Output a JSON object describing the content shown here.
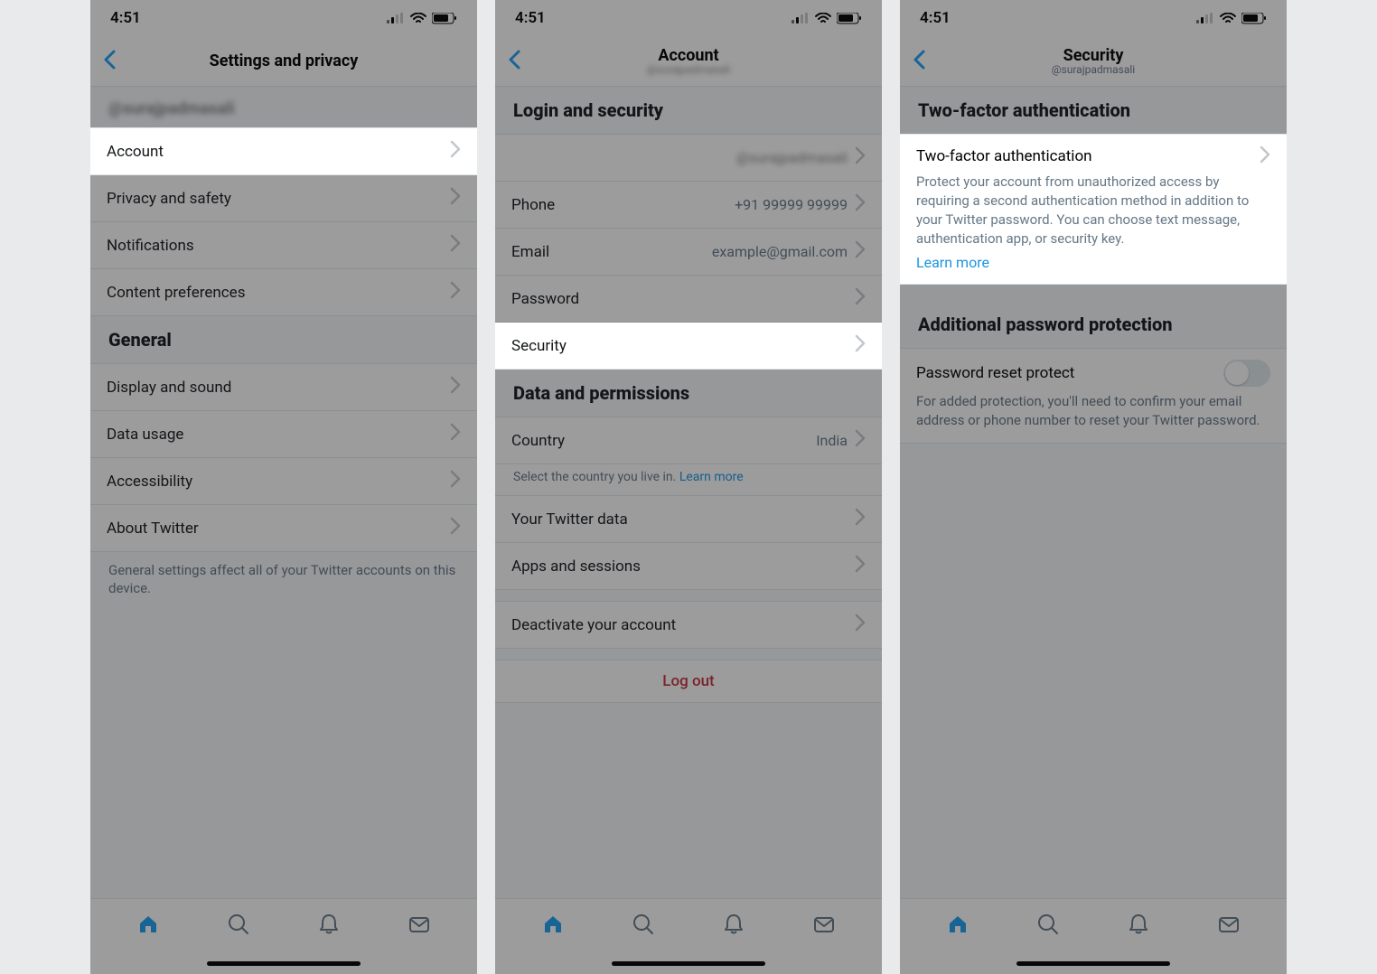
{
  "status": {
    "time": "4:51"
  },
  "screen1": {
    "title": "Settings and privacy",
    "username": "@surajpadmasali",
    "rows": {
      "account": "Account",
      "privacy": "Privacy and safety",
      "notifications": "Notifications",
      "content": "Content preferences"
    },
    "general_header": "General",
    "general": {
      "display": "Display and sound",
      "data": "Data usage",
      "accessibility": "Accessibility",
      "about": "About Twitter"
    },
    "general_note": "General settings affect all of your Twitter accounts on this device."
  },
  "screen2": {
    "title": "Account",
    "subtitle": "@surajpadmasali",
    "login_header": "Login and security",
    "rows": {
      "username_label": "",
      "username_value": "@surajpadmasali",
      "phone_label": "Phone",
      "phone_value": "+91 99999 99999",
      "email_label": "Email",
      "email_value": "example@gmail.com",
      "password_label": "Password",
      "security_label": "Security"
    },
    "data_header": "Data and permissions",
    "country_label": "Country",
    "country_value": "India",
    "country_note": "Select the country you live in. ",
    "country_learn": "Learn more",
    "twitter_data": "Your Twitter data",
    "apps": "Apps and sessions",
    "deactivate": "Deactivate your account",
    "logout": "Log out"
  },
  "screen3": {
    "title": "Security",
    "subtitle": "@surajpadmasali",
    "tfa_header": "Two-factor authentication",
    "tfa_title": "Two-factor authentication",
    "tfa_desc": "Protect your account from unauthorized access by requiring a second authentication method in addition to your Twitter password. You can choose text message, authentication app, or security key.",
    "tfa_learn": "Learn more",
    "add_header": "Additional password protection",
    "prp_title": "Password reset protect",
    "prp_desc": "For added protection, you'll need to confirm your email address or phone number to reset your Twitter password."
  }
}
